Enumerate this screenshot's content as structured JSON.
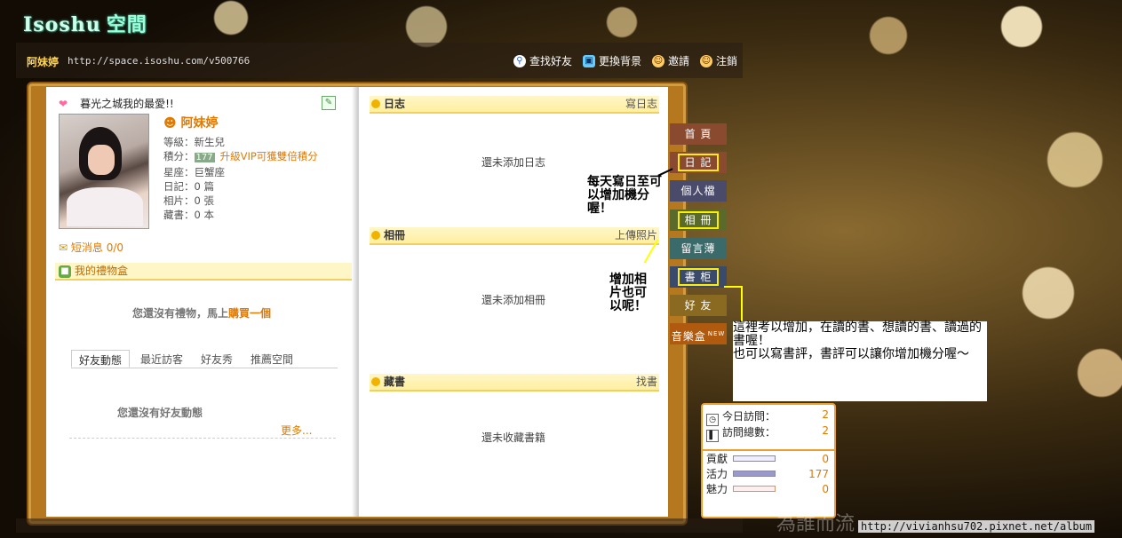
{
  "logo": {
    "latin": "Isoshu",
    "cn": "空間"
  },
  "header": {
    "owner": "阿妹婷",
    "url": "http://space.isoshu.com/v500766",
    "actions": [
      {
        "label": "查找好友",
        "icon": "search-icon"
      },
      {
        "label": "更換背景",
        "icon": "background-icon"
      },
      {
        "label": "邀請",
        "icon": "invite-icon"
      },
      {
        "label": "注銷",
        "icon": "logout-icon"
      }
    ]
  },
  "profile": {
    "motto": "暮光之城我的最愛!!",
    "name": "阿妹婷",
    "level": "等級：新生兒",
    "points_label": "積分：",
    "points": "177",
    "vip_text": "升級VIP可獲雙倍積分",
    "sign": "星座：巨蟹座",
    "diary": "日記：0 篇",
    "photos": "相片：0 張",
    "books": "藏書：0 本",
    "sms": "短消息 0/0"
  },
  "gift": {
    "title": "我的禮物盒",
    "empty": "您還沒有禮物，馬上",
    "buy": "購買一個"
  },
  "friend_tabs": [
    {
      "label": "好友動態",
      "active": true
    },
    {
      "label": "最近訪客",
      "active": false
    },
    {
      "label": "好友秀",
      "active": false
    },
    {
      "label": "推薦空間",
      "active": false
    }
  ],
  "friends": {
    "empty": "您還沒有好友動態",
    "more": "更多..."
  },
  "sections": {
    "diary": {
      "title": "日志",
      "action": "寫日志",
      "empty": "還未添加日志"
    },
    "album": {
      "title": "相冊",
      "action": "上傳照片",
      "empty": "還未添加相冊"
    },
    "books": {
      "title": "藏書",
      "action": "找書",
      "empty": "還未收藏書籍"
    }
  },
  "nav": [
    {
      "label": "首 頁",
      "color": "#8a4a30",
      "highlight": false
    },
    {
      "label": "日 記",
      "color": "#8a4a30",
      "highlight": true
    },
    {
      "label": "個人檔",
      "color": "#4a4a6a",
      "highlight": false
    },
    {
      "label": "相 冊",
      "color": "#5a6a2a",
      "highlight": true
    },
    {
      "label": "留言薄",
      "color": "#3a6a6a",
      "highlight": false
    },
    {
      "label": "書 柜",
      "color": "#3a4a6a",
      "highlight": true
    },
    {
      "label": "好 友",
      "color": "#8a6a20",
      "highlight": false
    },
    {
      "label": "音樂盒",
      "color": "#b05a10",
      "highlight": false,
      "badge": "NEW"
    }
  ],
  "notes": {
    "diary": "每天寫日至可以增加機分喔！",
    "album": "增加相片也可以呢！",
    "books_1": "這裡考以增加，在讀的書、想讀的書、讀過的書喔！",
    "books_2": "也可以寫書評，書評可以讓你增加機分喔～"
  },
  "stats": {
    "today_label": "今日訪問：",
    "today": "2",
    "total_label": "訪問總數：",
    "total": "2",
    "contrib_label": "貢獻",
    "contrib": "0",
    "activity_label": "活力",
    "activity": "177",
    "charm_label": "魅力",
    "charm": "0"
  },
  "bg_text": "為誰而流",
  "watermark": "http://vivianhsu702.pixnet.net/album"
}
